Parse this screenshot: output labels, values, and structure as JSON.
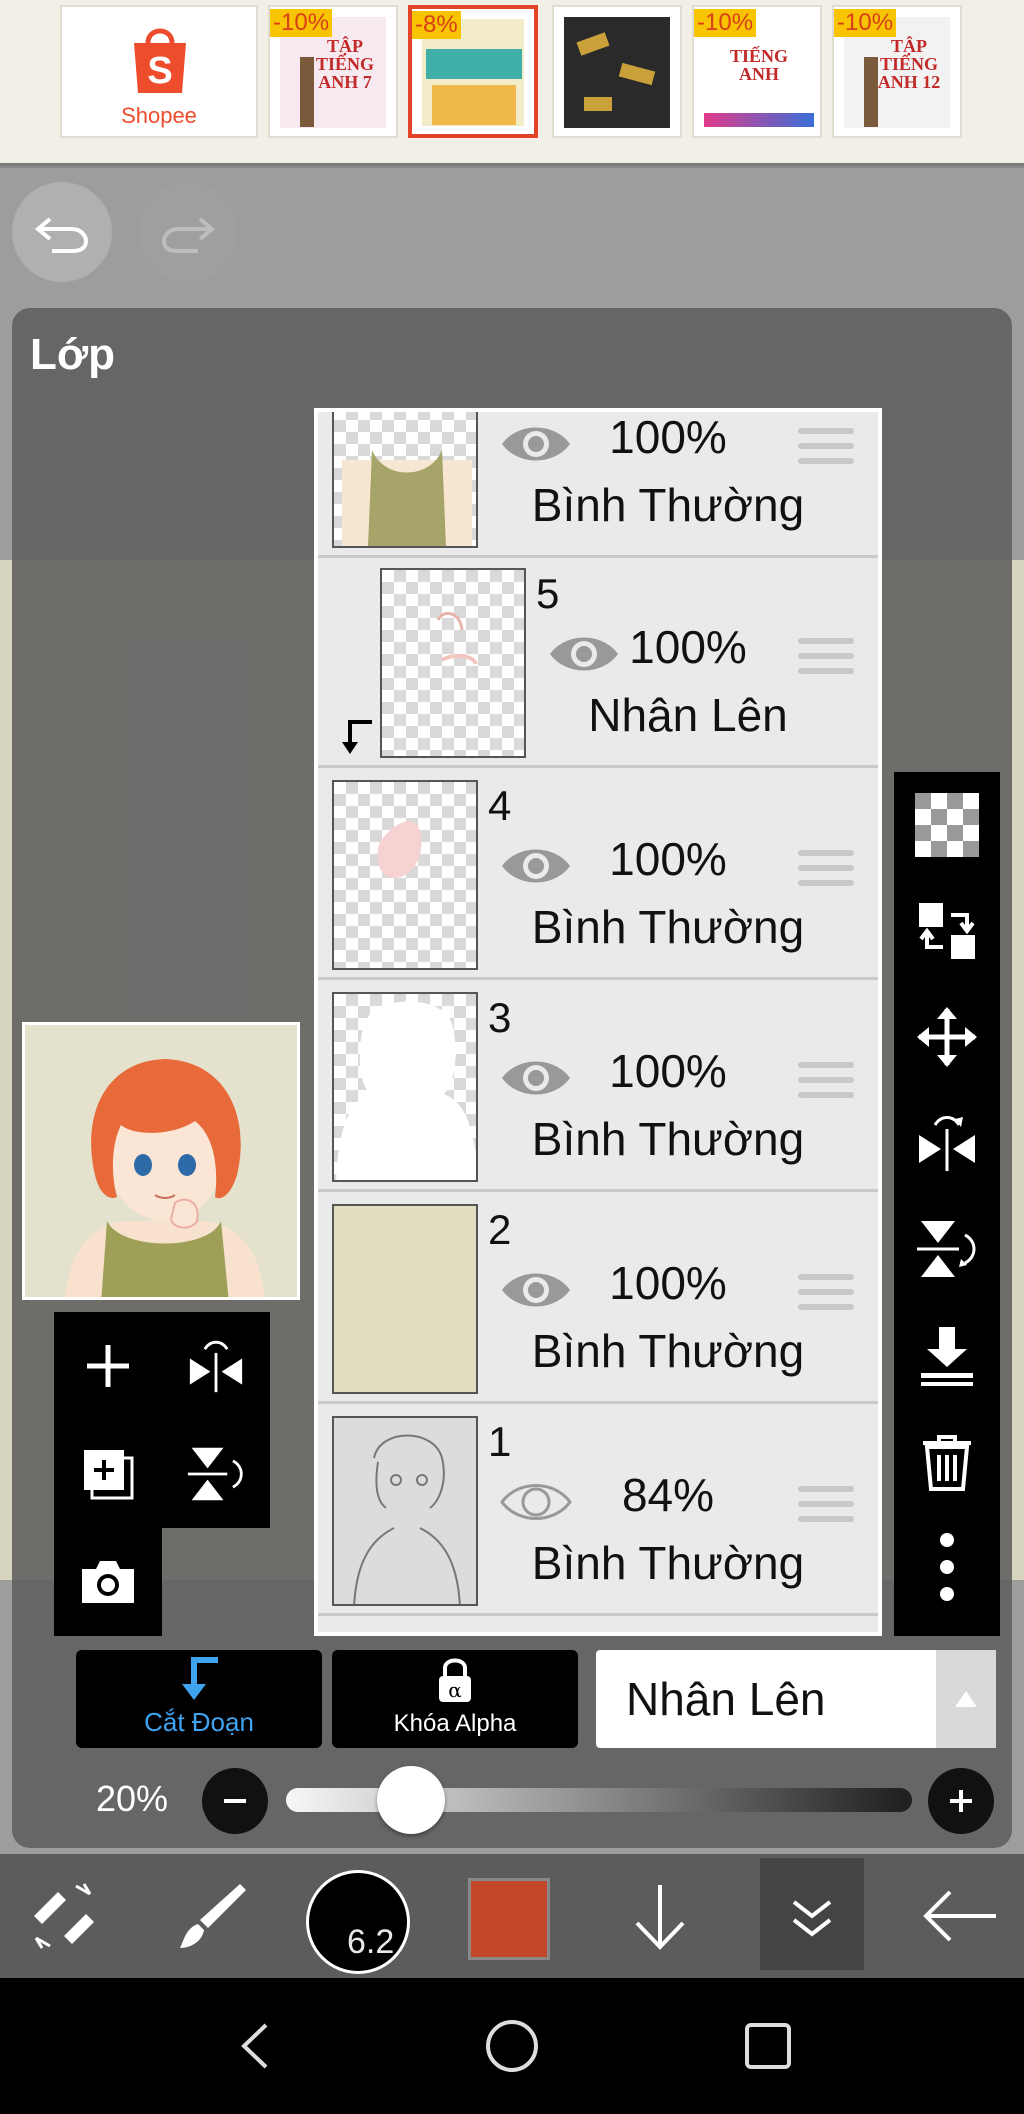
{
  "ad_banner": {
    "brand_label": "Shopee",
    "items": [
      {
        "badge": "-10%",
        "title": "TẬP TIẾNG ANH 7"
      },
      {
        "badge": "-8%",
        "title": ""
      },
      {
        "badge": "",
        "title": ""
      },
      {
        "badge": "-10%",
        "title": "TIẾNG ANH"
      },
      {
        "badge": "-10%",
        "title": "TẬP TIẾNG ANH 12"
      }
    ]
  },
  "panel": {
    "title": "Lớp"
  },
  "layers": [
    {
      "number": "",
      "opacity": "100%",
      "blend": "Bình Thường",
      "visible": true,
      "thumb": "shirt"
    },
    {
      "number": "5",
      "opacity": "100%",
      "blend": "Nhân Lên",
      "visible": true,
      "thumb": "blush",
      "clipped": true
    },
    {
      "number": "4",
      "opacity": "100%",
      "blend": "Bình Thường",
      "visible": true,
      "thumb": "hand"
    },
    {
      "number": "3",
      "opacity": "100%",
      "blend": "Bình Thường",
      "visible": true,
      "thumb": "white"
    },
    {
      "number": "2",
      "opacity": "100%",
      "blend": "Bình Thường",
      "visible": true,
      "thumb": "beige"
    },
    {
      "number": "1",
      "opacity": "84%",
      "blend": "Bình Thường",
      "visible": true,
      "thumb": "sketch"
    }
  ],
  "controls": {
    "clip_label": "Cắt Đoạn",
    "alpha_label": "Khóa Alpha",
    "blend_mode": "Nhân Lên",
    "opacity_value": "20%",
    "opacity_fraction": 0.2
  },
  "toolbar": {
    "brush_size": "6.2",
    "primary_color": "#c2472b"
  },
  "colors": {
    "accent_blue": "#3fa3f0",
    "panel_bg": "#5f5f5f",
    "canvas_bg": "#d8d5bf"
  }
}
